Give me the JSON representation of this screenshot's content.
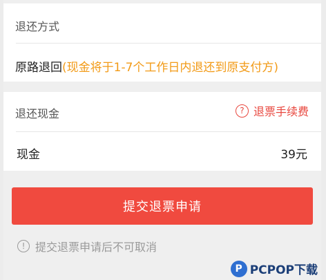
{
  "refund_method": {
    "title": "退还方式",
    "option": "原路退回",
    "option_note": "(现金将于1-7个工作日内退还到原支付方)"
  },
  "refund_cash": {
    "title": "退还现金",
    "fee_link": "退票手续费",
    "item_label": "现金",
    "item_amount": "39元"
  },
  "submit_button": "提交退票申请",
  "notice": "提交退票申请后不可取消",
  "watermark": "PCPOP下载",
  "colors": {
    "accent_orange": "#f29a16",
    "button_red": "#f04a3f",
    "link_red": "#e8463d"
  }
}
